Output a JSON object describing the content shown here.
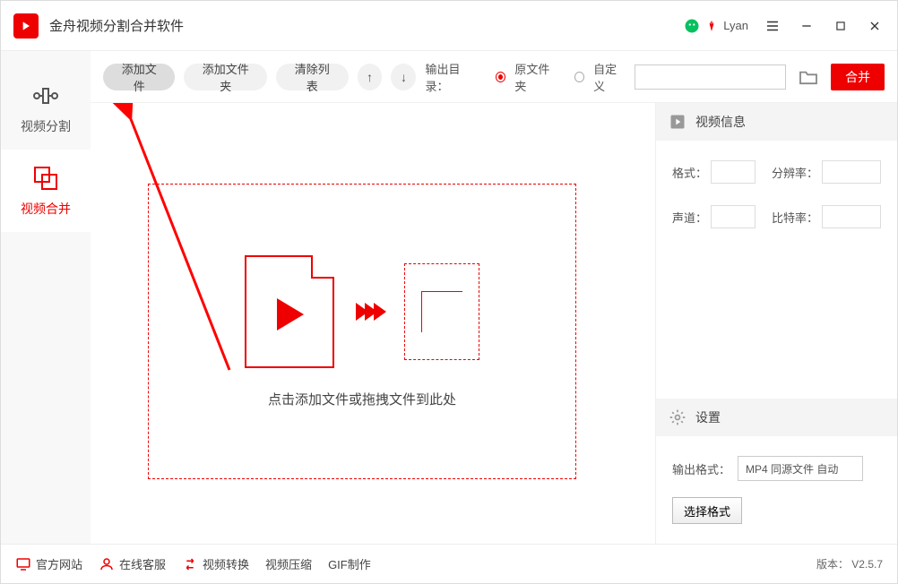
{
  "app": {
    "title": "金舟视频分割合并软件"
  },
  "user": {
    "name": "Lyan"
  },
  "sidebar": {
    "items": [
      {
        "label": "视频分割"
      },
      {
        "label": "视频合并"
      }
    ]
  },
  "toolbar": {
    "add_file": "添加文件",
    "add_folder": "添加文件夹",
    "clear_list": "清除列表",
    "output_label": "输出目录：",
    "radio_source": "原文件夹",
    "radio_custom": "自定义",
    "path_value": "",
    "merge": "合并"
  },
  "drop": {
    "hint": "点击添加文件或拖拽文件到此处"
  },
  "panel": {
    "video_info_title": "视频信息",
    "format_label": "格式：",
    "resolution_label": "分辨率：",
    "channel_label": "声道：",
    "bitrate_label": "比特率：",
    "settings_title": "设置",
    "output_format_label": "输出格式：",
    "output_format_value": "MP4 同源文件 自动",
    "choose_format": "选择格式"
  },
  "footer": {
    "site": "官方网站",
    "service": "在线客服",
    "convert": "视频转换",
    "compress": "视频压缩",
    "gif": "GIF制作",
    "version": "版本： V2.5.7"
  }
}
